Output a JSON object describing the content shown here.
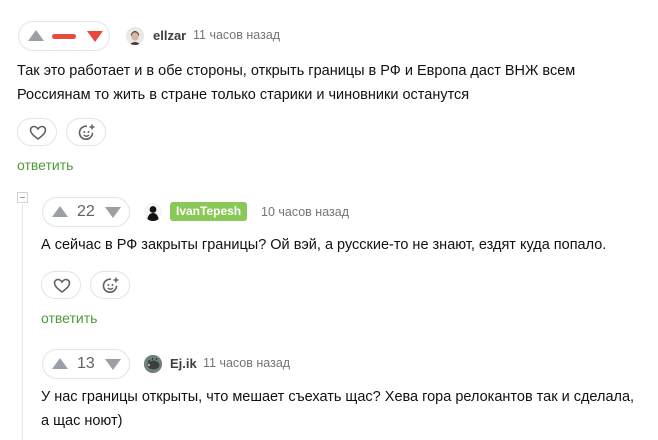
{
  "comments": [
    {
      "rating": "",
      "username": "ellzar",
      "time": "11 часов назад",
      "text": "Так это работает и в обе стороны, открыть границы в РФ и Европа даст ВНЖ всем Россиянам то жить в стране только старики и чиновники останутся",
      "reply_label": "ответить",
      "avatar_icon": "man-portrait-icon"
    },
    {
      "rating": "22",
      "username": "IvanTepesh",
      "time": "10 часов назад",
      "text": "А сейчас в РФ закрыты границы? Ой вэй, а русские-то не знают, ездят куда попало.",
      "reply_label": "ответить",
      "avatar_icon": "silhouette-icon",
      "badge_color": "#8ac858"
    },
    {
      "rating": "13",
      "username": "Ej.ik",
      "time": "11 часов назад",
      "text": "У нас границы открыты, что мешает съехать щас? Хева гора релокантов так и сделала, а щас ноют)",
      "avatar_icon": "hedgehog-icon"
    }
  ],
  "colors": {
    "accent_green": "#4f9a37",
    "negative_red": "#e8483d",
    "badge_green": "#8ac858"
  }
}
